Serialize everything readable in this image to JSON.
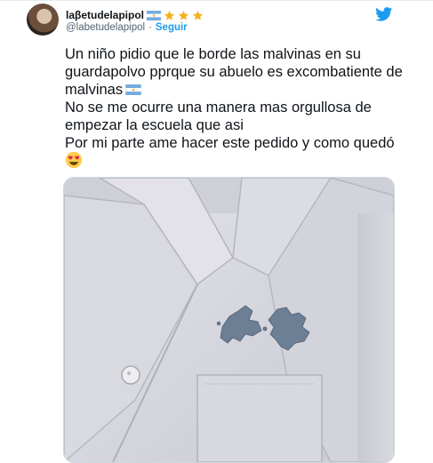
{
  "author": {
    "display_name": "laβetudelapipol",
    "handle": "@labetudelapipol",
    "separator": "·",
    "follow_label": "Seguir",
    "name_decorations": [
      "argentina-flag-icon",
      "star-icon",
      "star-icon",
      "star-icon"
    ]
  },
  "tweet": {
    "lines": [
      "Un niño pidio que le borde las malvinas en su",
      "guardapolvo pprque su abuelo es excombatiente de",
      "malvinas",
      "No se me ocurre una manera mas orgullosa de",
      "empezar la escuela que asi",
      "Por mi parte ame hacer este pedido y como quedó"
    ],
    "emoji": "smiling-face-with-heart-eyes-icon"
  },
  "media": {
    "description_icon": "embroidered-school-coat-image"
  },
  "colors": {
    "accent": "#1d9bf0",
    "text": "#0f1419",
    "secondary": "#536471",
    "embroidery": "#6d7f95"
  }
}
